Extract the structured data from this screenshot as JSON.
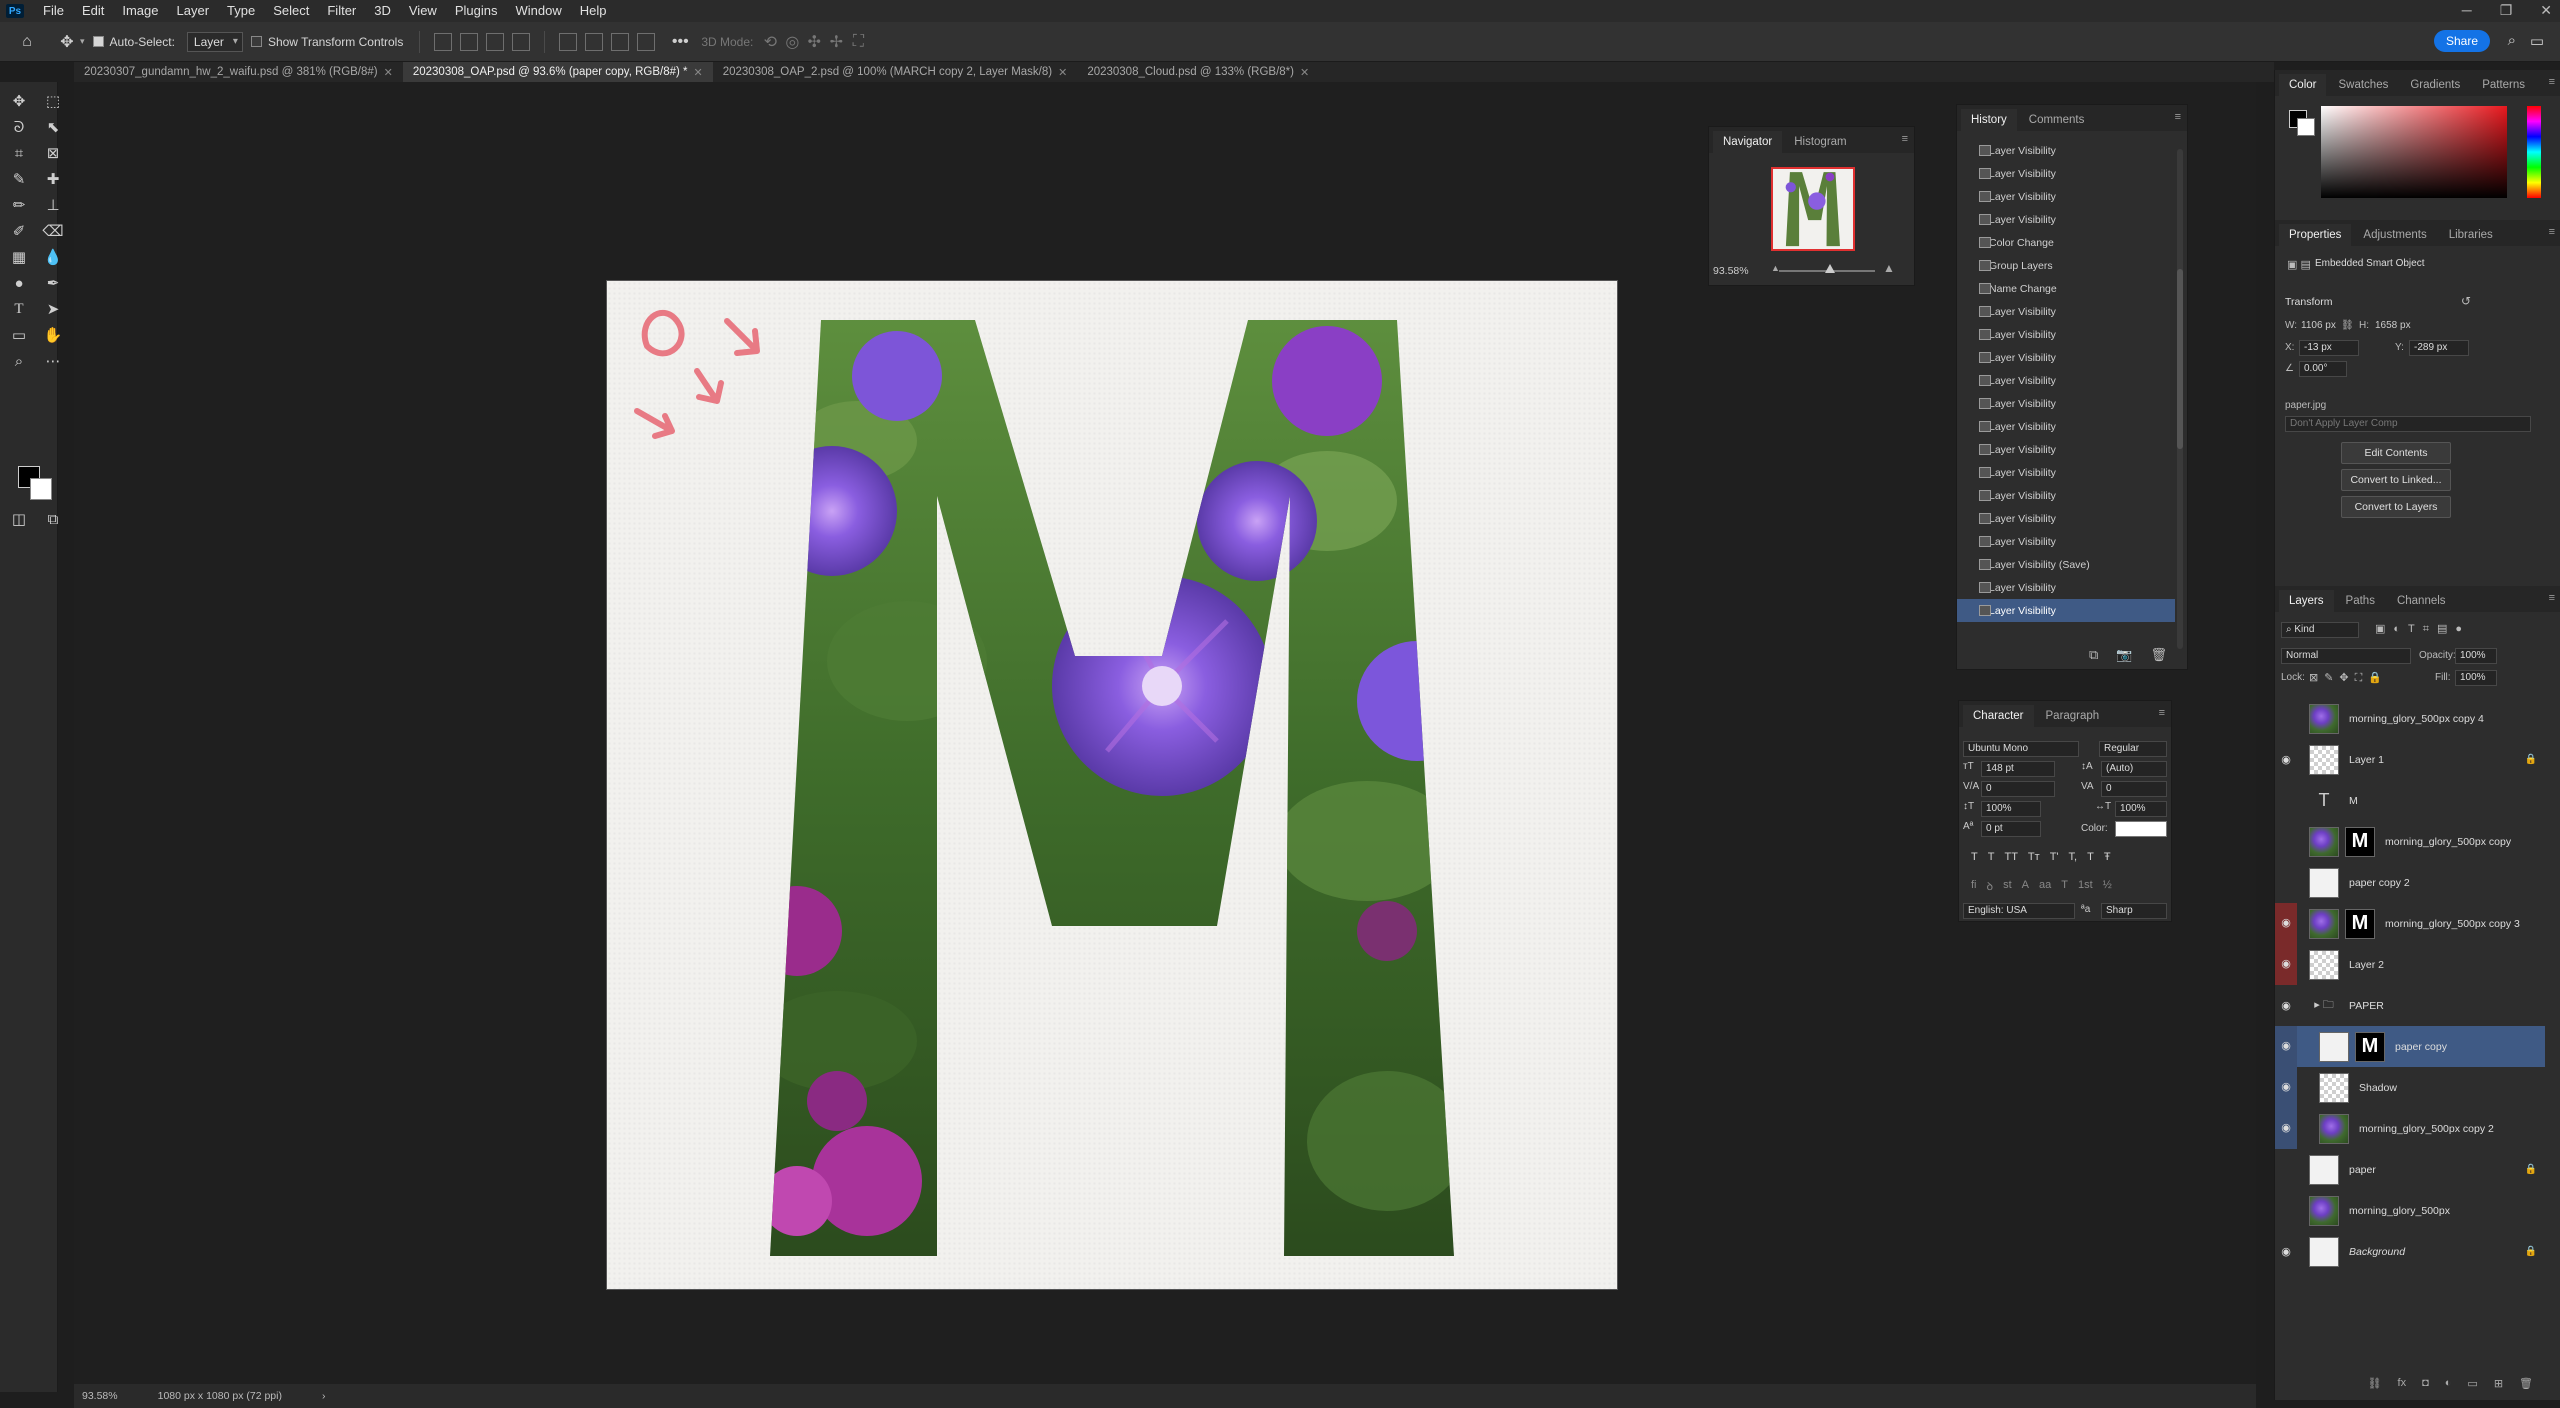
{
  "menubar": {
    "logo": "Ps",
    "items": [
      "File",
      "Edit",
      "Image",
      "Layer",
      "Type",
      "Select",
      "Filter",
      "3D",
      "View",
      "Plugins",
      "Window",
      "Help"
    ]
  },
  "options": {
    "auto_select": "Auto-Select:",
    "auto_select_value": "Layer",
    "show_transform": "Show Transform Controls",
    "mode_3d": "3D Mode:",
    "share": "Share"
  },
  "tabs": [
    {
      "label": "20230307_gundamn_hw_2_waifu.psd @ 381% (RGB/8#)",
      "active": false
    },
    {
      "label": "20230308_OAP.psd @ 93.6% (paper copy, RGB/8#) *",
      "active": true
    },
    {
      "label": "20230308_OAP_2.psd @ 100% (MARCH copy 2, Layer Mask/8)",
      "active": false
    },
    {
      "label": "20230308_Cloud.psd @ 133% (RGB/8*)",
      "active": false
    }
  ],
  "status": {
    "zoom": "93.58%",
    "doc_size": "1080 px x 1080 px (72 ppi)"
  },
  "navigator": {
    "tab1": "Navigator",
    "tab2": "Histogram",
    "zoom": "93.58%"
  },
  "history": {
    "tab1": "History",
    "tab2": "Comments",
    "rows": [
      "Layer Visibility",
      "Layer Visibility",
      "Layer Visibility",
      "Layer Visibility",
      "Color Change",
      "Group Layers",
      "Name Change",
      "Layer Visibility",
      "Layer Visibility",
      "Layer Visibility",
      "Layer Visibility",
      "Layer Visibility",
      "Layer Visibility",
      "Layer Visibility",
      "Layer Visibility",
      "Layer Visibility",
      "Layer Visibility",
      "Layer Visibility",
      "Layer Visibility (Save)",
      "Layer Visibility",
      "Layer Visibility"
    ],
    "active_index": 20
  },
  "character": {
    "tab1": "Character",
    "tab2": "Paragraph",
    "font": "Ubuntu Mono",
    "style": "Regular",
    "size": "148 pt",
    "leading": "(Auto)",
    "kerning": "0",
    "tracking": "0",
    "vscale": "100%",
    "hscale": "100%",
    "baseline": "0 pt",
    "color_label": "Color:",
    "language": "English: USA",
    "antialias": "Sharp",
    "styles": [
      "T",
      "T",
      "TT",
      "Tт",
      "T'",
      "T,",
      "T",
      "Ŧ"
    ],
    "otf": [
      "fi",
      "ꝺ",
      "st",
      "A",
      "aa",
      "T",
      "1st",
      "½"
    ]
  },
  "color_panel": {
    "tabs": [
      "Color",
      "Swatches",
      "Gradients",
      "Patterns"
    ]
  },
  "properties": {
    "tabs": [
      "Properties",
      "Adjustments",
      "Libraries"
    ],
    "type": "Embedded Smart Object",
    "transform": "Transform",
    "w": "1106 px",
    "h": "1658 px",
    "x": "-13 px",
    "y": "-289 px",
    "angle": "0.00°",
    "w_lbl": "W:",
    "h_lbl": "H:",
    "x_lbl": "X:",
    "y_lbl": "Y:",
    "source": "paper.jpg",
    "comp": "Don't Apply Layer Comp",
    "btn_edit": "Edit Contents",
    "btn_linked": "Convert to Linked...",
    "btn_layers": "Convert to Layers"
  },
  "layers": {
    "tabs": [
      "Layers",
      "Paths",
      "Channels"
    ],
    "kind": "Kind",
    "blend": "Normal",
    "opacity_lbl": "Opacity:",
    "opacity": "100%",
    "lock_lbl": "Lock:",
    "fill_lbl": "Fill:",
    "fill": "100%",
    "rows": [
      {
        "name": "morning_glory_500px copy 4",
        "thumb": "flower",
        "eye": "",
        "mask": false,
        "lock": false,
        "indent": 0
      },
      {
        "name": "Layer 1",
        "thumb": "checker",
        "eye": "👁",
        "mask": false,
        "lock": true,
        "indent": 0
      },
      {
        "name": "M",
        "thumb": "text",
        "eye": "",
        "mask": false,
        "lock": false,
        "indent": 0
      },
      {
        "name": "morning_glory_500px copy",
        "thumb": "flower",
        "eye": "",
        "mask": true,
        "lock": false,
        "indent": 0
      },
      {
        "name": "paper copy 2",
        "thumb": "white",
        "eye": "",
        "mask": false,
        "lock": false,
        "indent": 0
      },
      {
        "name": "morning_glory_500px copy 3",
        "thumb": "flower",
        "eye": "👁",
        "mask": true,
        "lock": false,
        "indent": 0,
        "eyecolor": "red"
      },
      {
        "name": "Layer 2",
        "thumb": "checker",
        "eye": "👁",
        "mask": false,
        "lock": false,
        "indent": 0,
        "eyecolor": "red"
      },
      {
        "name": "PAPER",
        "thumb": "folder",
        "eye": "👁",
        "mask": false,
        "lock": false,
        "indent": 0
      },
      {
        "name": "paper copy",
        "thumb": "white",
        "eye": "👁",
        "mask": true,
        "lock": false,
        "indent": 1,
        "eyecolor": "blue",
        "selected": true
      },
      {
        "name": "Shadow",
        "thumb": "checker",
        "eye": "👁",
        "mask": false,
        "lock": false,
        "indent": 1,
        "eyecolor": "blue"
      },
      {
        "name": "morning_glory_500px copy 2",
        "thumb": "flower",
        "eye": "👁",
        "mask": false,
        "lock": false,
        "indent": 1,
        "eyecolor": "blue"
      },
      {
        "name": "paper",
        "thumb": "white",
        "eye": "",
        "mask": false,
        "lock": true,
        "indent": 0
      },
      {
        "name": "morning_glory_500px",
        "thumb": "flower",
        "eye": "",
        "mask": false,
        "lock": false,
        "indent": 0
      },
      {
        "name": "Background",
        "thumb": "white",
        "eye": "👁",
        "mask": false,
        "lock": true,
        "indent": 0,
        "italic": true
      }
    ]
  },
  "colors": {
    "accent": "#1473e6",
    "selection": "#3f5a85",
    "doodle": "#e87a84"
  }
}
